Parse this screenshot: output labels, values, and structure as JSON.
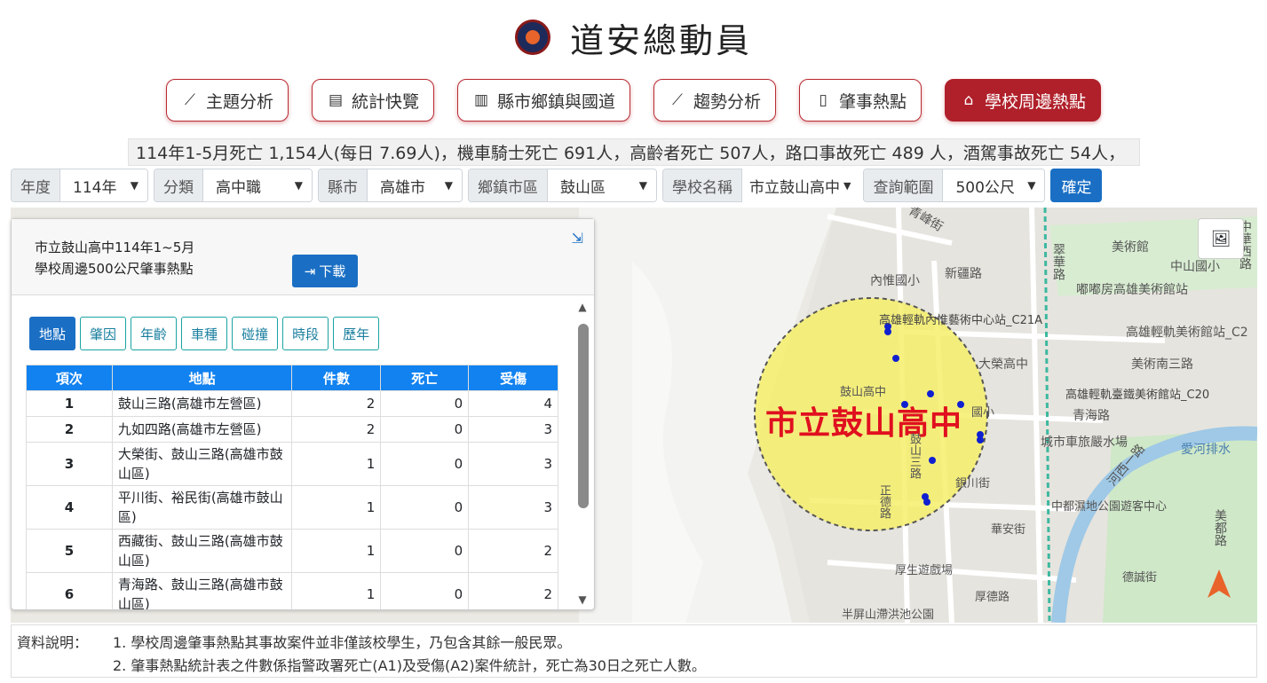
{
  "header": {
    "title": "道安總動員"
  },
  "nav": [
    {
      "label": "主題分析",
      "icon": "line-chart-icon",
      "active": false
    },
    {
      "label": "統計快覽",
      "icon": "newspaper-icon",
      "active": false
    },
    {
      "label": "縣市鄉鎮與國道",
      "icon": "bar-chart-icon",
      "active": false
    },
    {
      "label": "趨勢分析",
      "icon": "line-chart-icon",
      "active": false
    },
    {
      "label": "肇事熱點",
      "icon": "map-icon",
      "active": false
    },
    {
      "label": "學校周邊熱點",
      "icon": "school-icon",
      "active": true
    }
  ],
  "ticker": "114年1-5月死亡 1,154人(每日 7.69人)，機車騎士死亡 691人，高齡者死亡 507人，路口事故死亡 489 人，酒駕事故死亡 54人，",
  "filters": {
    "year_label": "年度",
    "year_value": "114年",
    "category_label": "分類",
    "category_value": "高中職",
    "county_label": "縣市",
    "county_value": "高雄市",
    "town_label": "鄉鎮市區",
    "town_value": "鼓山區",
    "school_label": "學校名稱",
    "school_value": "市立鼓山高中",
    "range_label": "查詢範圍",
    "range_value": "500公尺",
    "confirm": "確定"
  },
  "panel": {
    "title_line1": "市立鼓山高中114年1~5月",
    "title_line2": "學校周邊500公尺肇事熱點",
    "download": "下載",
    "tabs": [
      "地點",
      "肇因",
      "年齡",
      "車種",
      "碰撞",
      "時段",
      "歷年"
    ],
    "columns": [
      "項次",
      "地點",
      "件數",
      "死亡",
      "受傷"
    ],
    "rows": [
      {
        "no": "1",
        "loc": "鼓山三路(高雄市左營區)",
        "cases": "2",
        "death": "0",
        "injury": "4"
      },
      {
        "no": "2",
        "loc": "九如四路(高雄市左營區)",
        "cases": "2",
        "death": "0",
        "injury": "3"
      },
      {
        "no": "3",
        "loc": "大榮街、鼓山三路(高雄市鼓山區)",
        "cases": "1",
        "death": "0",
        "injury": "3"
      },
      {
        "no": "4",
        "loc": "平川街、裕民街(高雄市鼓山區)",
        "cases": "1",
        "death": "0",
        "injury": "3"
      },
      {
        "no": "5",
        "loc": "西藏街、鼓山三路(高雄市鼓山區)",
        "cases": "1",
        "death": "0",
        "injury": "2"
      },
      {
        "no": "6",
        "loc": "青海路、鼓山三路(高雄市鼓山區)",
        "cases": "1",
        "death": "0",
        "injury": "2"
      }
    ]
  },
  "map": {
    "school_label": "市立鼓山高中",
    "place_labels": [
      "青峰街",
      "新疆路",
      "內惟國小",
      "美術館",
      "中山國小",
      "翠華路",
      "嘟嘟房高雄美術館站",
      "高雄輕軌內惟藝術中心站_C21A",
      "高雄輕軌美術館站_C2",
      "美術南三路",
      "大榮高中",
      "鼓山高中",
      "國小",
      "高雄輕軌臺鐵美術館站_C20",
      "青海路",
      "城市車旅嚴水場",
      "愛河排水",
      "河西一路",
      "中華西路",
      "中都濕地公園遊客中心",
      "美都路",
      "鼓山三路",
      "銀川街",
      "正德路",
      "華安街",
      "厚生遊戲場",
      "厚德路",
      "德誠街",
      "半屏山滯洪池公園"
    ]
  },
  "notes": {
    "label": "資料說明：",
    "line1": "1. 學校周邊肇事熱點其事故案件並非僅該校學生，乃包含其餘一般民眾。",
    "line2": "2. 肇事熱點統計表之件數係指警政署死亡(A1)及受傷(A2)案件統計，死亡為30日之死亡人數。"
  }
}
